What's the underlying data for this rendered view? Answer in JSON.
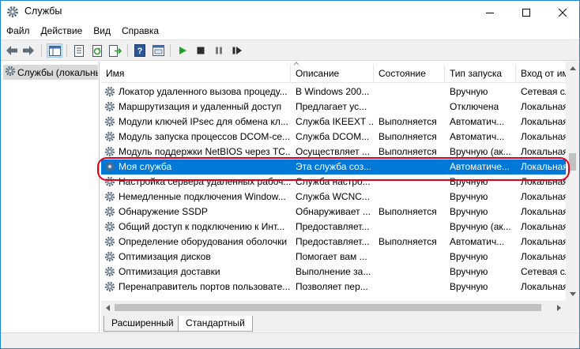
{
  "window": {
    "title": "Службы",
    "accent": "#0078d7"
  },
  "menu": [
    "Файл",
    "Действие",
    "Вид",
    "Справка"
  ],
  "toolbar": {
    "icons": [
      "back-arrow-icon",
      "forward-arrow-icon",
      "show-tree-icon",
      "properties-icon",
      "refresh-icon",
      "export-icon",
      "help-icon",
      "console-icon",
      "start-icon",
      "stop-icon",
      "pause-icon",
      "restart-icon"
    ]
  },
  "tree": {
    "root_label": "Службы (локальны"
  },
  "list": {
    "columns": [
      "Имя",
      "Описание",
      "Состояние",
      "Тип запуска",
      "Вход от им"
    ],
    "rows": [
      {
        "name": "Локатор удаленного вызова процеду...",
        "desc": "В Windows 200...",
        "state": "",
        "start": "Вручную",
        "logon": "Сетевая сл"
      },
      {
        "name": "Маршрутизация и удаленный доступ",
        "desc": "Предлагает ус...",
        "state": "",
        "start": "Отключена",
        "logon": "Локальная"
      },
      {
        "name": "Модули ключей IPsec для обмена кл...",
        "desc": "Служба IKEEXT ...",
        "state": "Выполняется",
        "start": "Автоматич...",
        "logon": "Локальная"
      },
      {
        "name": "Модуль запуска процессов DCOM-се...",
        "desc": "Служба DCOM...",
        "state": "Выполняется",
        "start": "Автоматич...",
        "logon": "Локальная"
      },
      {
        "name": "Модуль поддержки NetBIOS через TC...",
        "desc": "Осуществляет ...",
        "state": "Выполняется",
        "start": "Вручную (ак...",
        "logon": "Локальная"
      },
      {
        "name": "Моя служба",
        "desc": "Эта служба соз...",
        "state": "",
        "start": "Автоматиче...",
        "logon": "Локальная",
        "selected": true
      },
      {
        "name": "Настройка сервера удаленных рабоч...",
        "desc": "Служба настро...",
        "state": "",
        "start": "Вручную",
        "logon": "Локальная"
      },
      {
        "name": "Немедленные подключения Window...",
        "desc": "Служба WCNC...",
        "state": "",
        "start": "Вручную",
        "logon": "Локальная"
      },
      {
        "name": "Обнаружение SSDP",
        "desc": "Обнаруживает ...",
        "state": "Выполняется",
        "start": "Вручную",
        "logon": "Локальная"
      },
      {
        "name": "Общий доступ к подключению к Инт...",
        "desc": "Предоставляет...",
        "state": "",
        "start": "Вручную (ак...",
        "logon": "Локальная"
      },
      {
        "name": "Определение оборудования оболочки",
        "desc": "Предоставляет...",
        "state": "Выполняется",
        "start": "Автоматич...",
        "logon": "Локальная"
      },
      {
        "name": "Оптимизация дисков",
        "desc": "Помогает вам ...",
        "state": "",
        "start": "Вручную",
        "logon": "Локальная"
      },
      {
        "name": "Оптимизация доставки",
        "desc": "Выполнение за...",
        "state": "",
        "start": "Вручную",
        "logon": "Сетевая сл"
      },
      {
        "name": "Перенаправитель портов пользовате...",
        "desc": "Позволяет пер...",
        "state": "",
        "start": "Вручную",
        "logon": "Локальная"
      }
    ]
  },
  "tabs": [
    "Расширенный",
    "Стандартный"
  ],
  "highlight_color": "#e0001b"
}
